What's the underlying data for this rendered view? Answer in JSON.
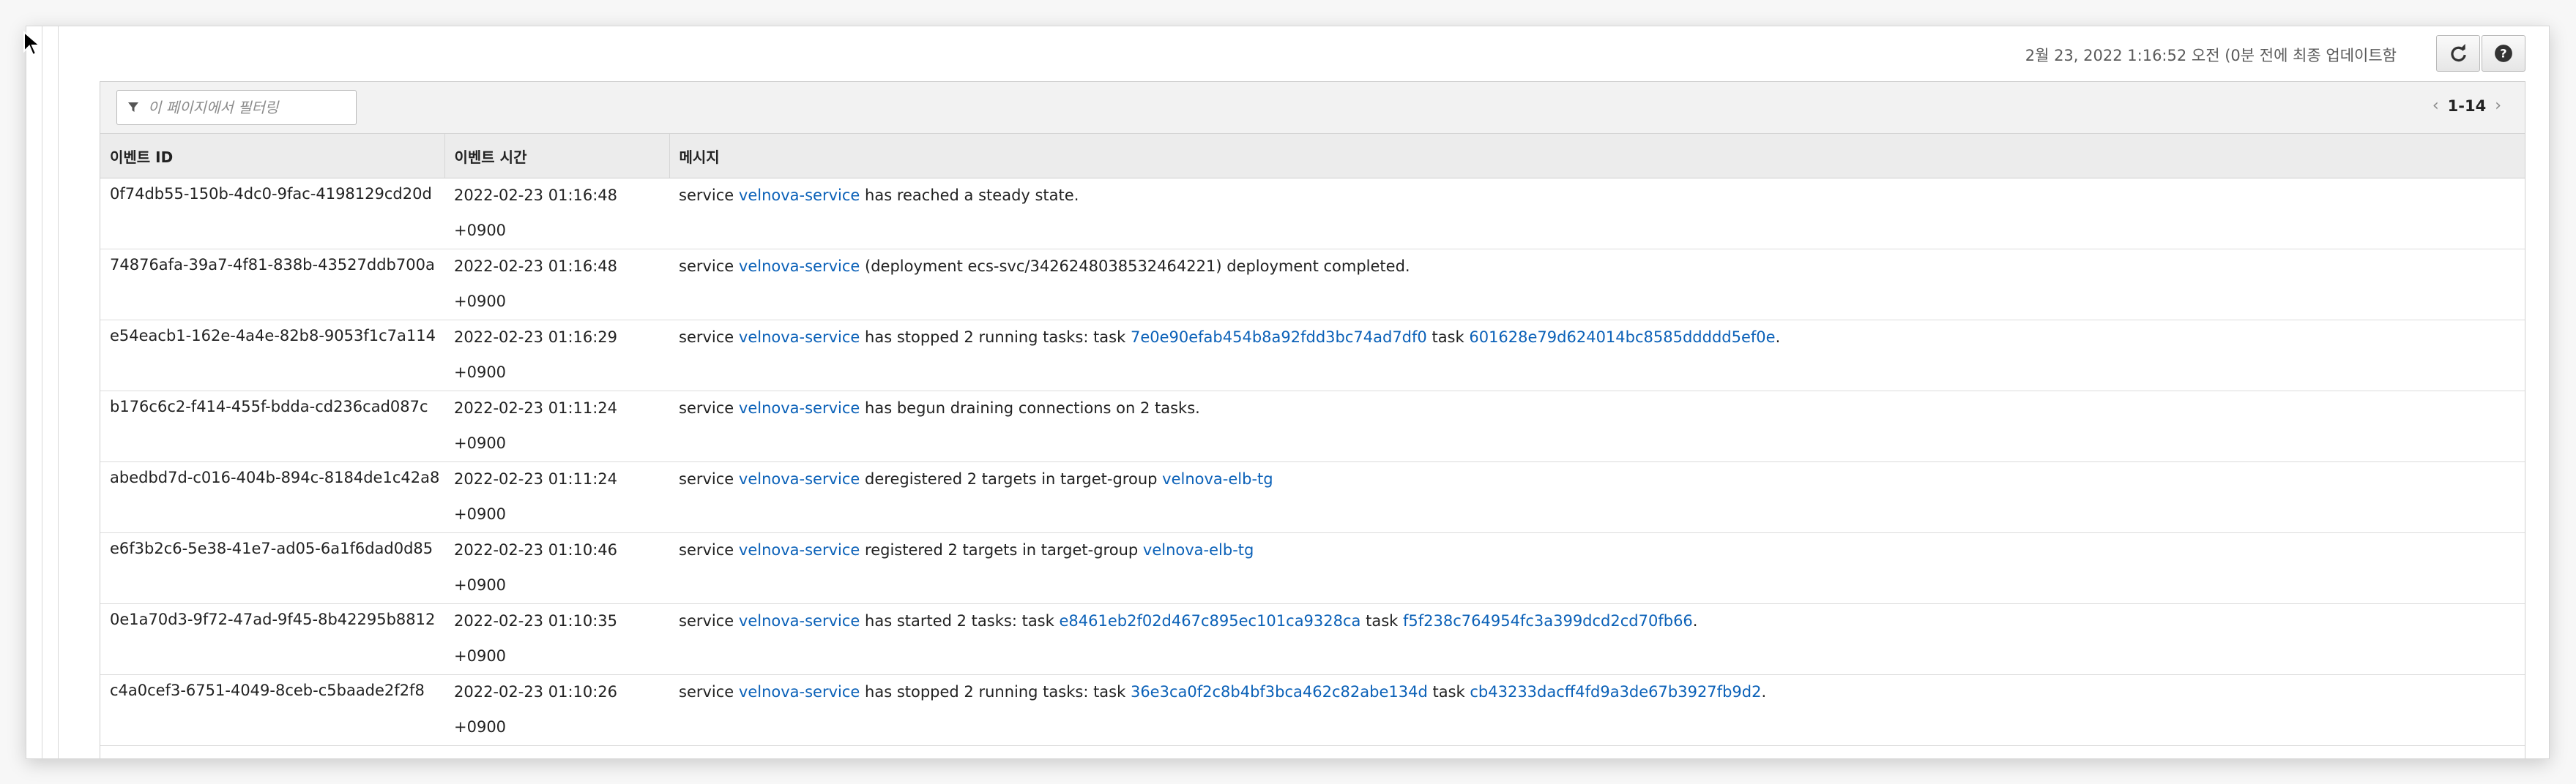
{
  "header": {
    "last_updated": "2월 23, 2022 1:16:52 오전 (0분 전에 최종 업데이트함",
    "refresh_icon": "refresh-icon",
    "help_icon": "help-icon"
  },
  "filter": {
    "placeholder": "이 페이지에서 필터링",
    "value": ""
  },
  "pagination": {
    "range": "1-14",
    "prev_icon": "chevron-left-icon",
    "next_icon": "chevron-right-icon"
  },
  "table": {
    "columns": [
      "이벤트 ID",
      "이벤트 시간",
      "메시지"
    ],
    "rows": [
      {
        "id": "0f74db55-150b-4dc0-9fac-4198129cd20d",
        "date": "2022-02-23 01:16:48",
        "tz": "+0900",
        "message": [
          {
            "t": "service "
          },
          {
            "t": "velnova-service",
            "link": true
          },
          {
            "t": " has reached a steady state."
          }
        ]
      },
      {
        "id": "74876afa-39a7-4f81-838b-43527ddb700a",
        "date": "2022-02-23 01:16:48",
        "tz": "+0900",
        "message": [
          {
            "t": "service "
          },
          {
            "t": "velnova-service",
            "link": true
          },
          {
            "t": " (deployment ecs-svc/3426248038532464221) deployment completed."
          }
        ]
      },
      {
        "id": "e54eacb1-162e-4a4e-82b8-9053f1c7a114",
        "date": "2022-02-23 01:16:29",
        "tz": "+0900",
        "message": [
          {
            "t": "service "
          },
          {
            "t": "velnova-service",
            "link": true
          },
          {
            "t": " has stopped 2 running tasks: task "
          },
          {
            "t": "7e0e90efab454b8a92fdd3bc74ad7df0",
            "link": true
          },
          {
            "t": " task "
          },
          {
            "t": "601628e79d624014bc8585ddddd5ef0e",
            "link": true
          },
          {
            "t": "."
          }
        ]
      },
      {
        "id": "b176c6c2-f414-455f-bdda-cd236cad087c",
        "date": "2022-02-23 01:11:24",
        "tz": "+0900",
        "message": [
          {
            "t": "service "
          },
          {
            "t": "velnova-service",
            "link": true
          },
          {
            "t": " has begun draining connections on 2 tasks."
          }
        ]
      },
      {
        "id": "abedbd7d-c016-404b-894c-8184de1c42a8",
        "date": "2022-02-23 01:11:24",
        "tz": "+0900",
        "message": [
          {
            "t": "service "
          },
          {
            "t": "velnova-service",
            "link": true
          },
          {
            "t": " deregistered 2 targets in target-group "
          },
          {
            "t": "velnova-elb-tg",
            "link": true
          }
        ]
      },
      {
        "id": "e6f3b2c6-5e38-41e7-ad05-6a1f6dad0d85",
        "date": "2022-02-23 01:10:46",
        "tz": "+0900",
        "message": [
          {
            "t": "service "
          },
          {
            "t": "velnova-service",
            "link": true
          },
          {
            "t": " registered 2 targets in target-group "
          },
          {
            "t": "velnova-elb-tg",
            "link": true
          }
        ]
      },
      {
        "id": "0e1a70d3-9f72-47ad-9f45-8b42295b8812",
        "date": "2022-02-23 01:10:35",
        "tz": "+0900",
        "message": [
          {
            "t": "service "
          },
          {
            "t": "velnova-service",
            "link": true
          },
          {
            "t": " has started 2 tasks: task "
          },
          {
            "t": "e8461eb2f02d467c895ec101ca9328ca",
            "link": true
          },
          {
            "t": " task "
          },
          {
            "t": "f5f238c764954fc3a399dcd2cd70fb66",
            "link": true
          },
          {
            "t": "."
          }
        ]
      },
      {
        "id": "c4a0cef3-6751-4049-8ceb-c5baade2f2f8",
        "date": "2022-02-23 01:10:26",
        "tz": "+0900",
        "message": [
          {
            "t": "service "
          },
          {
            "t": "velnova-service",
            "link": true
          },
          {
            "t": " has stopped 2 running tasks: task "
          },
          {
            "t": "36e3ca0f2c8b4bf3bca462c82abe134d",
            "link": true
          },
          {
            "t": " task "
          },
          {
            "t": "cb43233dacff4fd9a3de67b3927fb9d2",
            "link": true
          },
          {
            "t": "."
          }
        ]
      }
    ]
  },
  "colors": {
    "link": "#0b61b8",
    "header_bg": "#ececec"
  }
}
